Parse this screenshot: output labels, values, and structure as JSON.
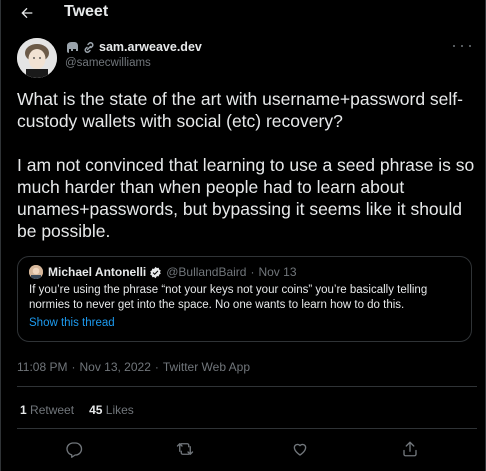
{
  "header": {
    "title": "Tweet",
    "back_icon": "back-arrow-icon"
  },
  "author": {
    "display_name": "sam.arweave.dev",
    "handle": "@samecwilliams",
    "emoji_icons": [
      "elephant-icon",
      "link-icon"
    ]
  },
  "tweet": {
    "paragraphs": [
      "What is the state of the art with username+password self-custody wallets with social (etc) recovery?",
      "I am not convinced that learning to use a seed phrase is so much harder than when people had to learn about unames+passwords, but bypassing it seems like it should be possible."
    ]
  },
  "quote": {
    "name": "Michael Antonelli",
    "handle": "@BullandBaird",
    "separator": "·",
    "date": "Nov 13",
    "text": "If you’re using the phrase “not your keys not your coins” you’re basically telling normies to never get into the space.  No one wants to learn how to do this.",
    "show_thread": "Show this thread"
  },
  "meta": {
    "time": "11:08 PM",
    "date": "Nov 13, 2022",
    "separator": "·",
    "source": "Twitter Web App"
  },
  "stats": {
    "retweets_count": "1",
    "retweets_label": "Retweet",
    "likes_count": "45",
    "likes_label": "Likes"
  },
  "actions": [
    "reply-icon",
    "retweet-icon",
    "like-icon",
    "share-icon"
  ],
  "colors": {
    "background": "#000000",
    "text": "#e7e9ea",
    "muted": "#71767b",
    "accent": "#1d9bf0",
    "border": "#2f3336"
  }
}
